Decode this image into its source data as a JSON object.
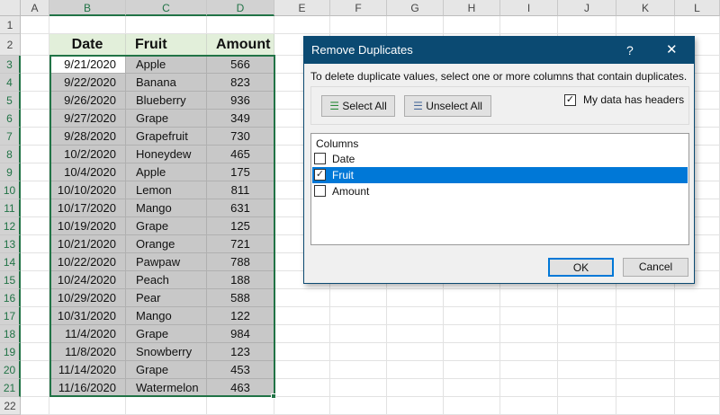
{
  "spreadsheet": {
    "columns": [
      "A",
      "B",
      "C",
      "D",
      "E",
      "F",
      "G",
      "H",
      "I",
      "J",
      "K",
      "L"
    ],
    "rows": [
      "1",
      "2",
      "3",
      "4",
      "5",
      "6",
      "7",
      "8",
      "9",
      "10",
      "11",
      "12",
      "13",
      "14",
      "15",
      "16",
      "17",
      "18",
      "19",
      "20",
      "21",
      "22"
    ],
    "headers": [
      "Date",
      "Fruit",
      "Amount"
    ],
    "data": [
      [
        "9/21/2020",
        "Apple",
        "566"
      ],
      [
        "9/22/2020",
        "Banana",
        "823"
      ],
      [
        "9/26/2020",
        "Blueberry",
        "936"
      ],
      [
        "9/27/2020",
        "Grape",
        "349"
      ],
      [
        "9/28/2020",
        "Grapefruit",
        "730"
      ],
      [
        "10/2/2020",
        "Honeydew",
        "465"
      ],
      [
        "10/4/2020",
        "Apple",
        "175"
      ],
      [
        "10/10/2020",
        "Lemon",
        "811"
      ],
      [
        "10/17/2020",
        "Mango",
        "631"
      ],
      [
        "10/19/2020",
        "Grape",
        "125"
      ],
      [
        "10/21/2020",
        "Orange",
        "721"
      ],
      [
        "10/22/2020",
        "Pawpaw",
        "788"
      ],
      [
        "10/24/2020",
        "Peach",
        "188"
      ],
      [
        "10/29/2020",
        "Pear",
        "588"
      ],
      [
        "10/31/2020",
        "Mango",
        "122"
      ],
      [
        "11/4/2020",
        "Grape",
        "984"
      ],
      [
        "11/8/2020",
        "Snowberry",
        "123"
      ],
      [
        "11/14/2020",
        "Grape",
        "453"
      ],
      [
        "11/16/2020",
        "Watermelon",
        "463"
      ]
    ]
  },
  "dialog": {
    "title": "Remove Duplicates",
    "help": "?",
    "close": "✕",
    "instruction": "To delete duplicate values, select one or more columns that contain duplicates.",
    "select_all": "Select All",
    "unselect_all": "Unselect All",
    "headers_label": "My data has headers",
    "headers_checked": true,
    "columns_label": "Columns",
    "columns": [
      {
        "label": "Date",
        "checked": false,
        "selected": false
      },
      {
        "label": "Fruit",
        "checked": true,
        "selected": true
      },
      {
        "label": "Amount",
        "checked": false,
        "selected": false
      }
    ],
    "ok": "OK",
    "cancel": "Cancel",
    "accent": "#0078d7"
  }
}
